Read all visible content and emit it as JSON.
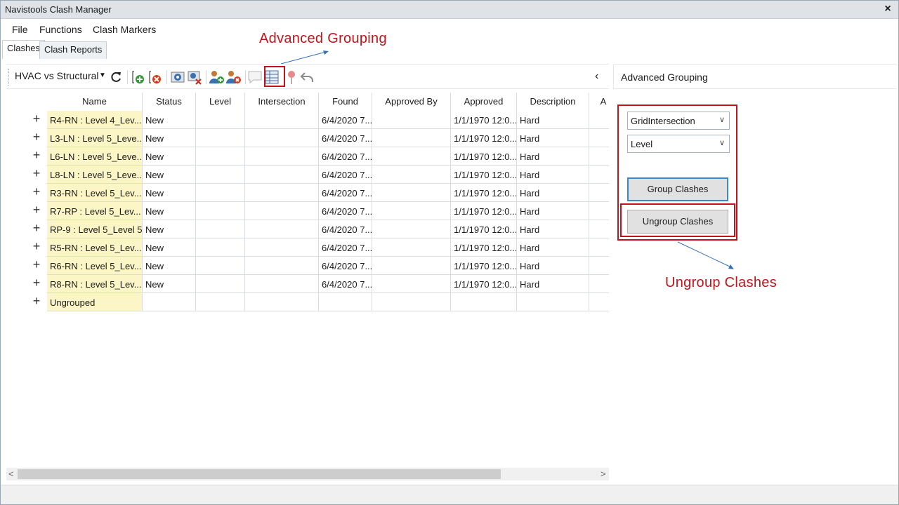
{
  "window": {
    "title": "Navistools Clash Manager",
    "close_label": "×"
  },
  "menu": [
    "File",
    "Functions",
    "Clash Markers"
  ],
  "tabs": [
    "Clashes",
    "Clash Reports"
  ],
  "annotations": {
    "advanced_grouping": "Advanced Grouping",
    "ungroup_clashes": "Ungroup Clashes",
    "color": "#c0141a"
  },
  "toolbar": {
    "test_selector": "HVAC vs Structural",
    "collapse_label": "‹",
    "icons": [
      "refresh-icon",
      "add-clash-icon",
      "remove-clash-icon",
      "view-clash-icon",
      "clear-view-icon",
      "assign-user-icon",
      "unassign-user-icon",
      "comment-icon",
      "advanced-grouping-icon",
      "marker-pin-icon",
      "undo-icon"
    ]
  },
  "grid": {
    "columns": [
      "Name",
      "Status",
      "Level",
      "Intersection",
      "Found",
      "Approved By",
      "Approved",
      "Description",
      "A"
    ],
    "rows": [
      {
        "expander": "+",
        "name": "R4-RN : Level 4_Lev...",
        "status": "New",
        "level": "",
        "intersection": "",
        "found": "6/4/2020 7...",
        "approved_by": "",
        "approved": "1/1/1970 12:0...",
        "description": "Hard"
      },
      {
        "expander": "+",
        "name": "L3-LN : Level 5_Leve...",
        "status": "New",
        "level": "",
        "intersection": "",
        "found": "6/4/2020 7...",
        "approved_by": "",
        "approved": "1/1/1970 12:0...",
        "description": "Hard"
      },
      {
        "expander": "+",
        "name": "L6-LN : Level 5_Leve...",
        "status": "New",
        "level": "",
        "intersection": "",
        "found": "6/4/2020 7...",
        "approved_by": "",
        "approved": "1/1/1970 12:0...",
        "description": "Hard"
      },
      {
        "expander": "+",
        "name": "L8-LN : Level 5_Leve...",
        "status": "New",
        "level": "",
        "intersection": "",
        "found": "6/4/2020 7...",
        "approved_by": "",
        "approved": "1/1/1970 12:0...",
        "description": "Hard"
      },
      {
        "expander": "+",
        "name": "R3-RN : Level 5_Lev...",
        "status": "New",
        "level": "",
        "intersection": "",
        "found": "6/4/2020 7...",
        "approved_by": "",
        "approved": "1/1/1970 12:0...",
        "description": "Hard"
      },
      {
        "expander": "+",
        "name": "R7-RP : Level 5_Lev...",
        "status": "New",
        "level": "",
        "intersection": "",
        "found": "6/4/2020 7...",
        "approved_by": "",
        "approved": "1/1/1970 12:0...",
        "description": "Hard"
      },
      {
        "expander": "+",
        "name": "RP-9 : Level 5_Level 5",
        "status": "New",
        "level": "",
        "intersection": "",
        "found": "6/4/2020 7...",
        "approved_by": "",
        "approved": "1/1/1970 12:0...",
        "description": "Hard"
      },
      {
        "expander": "+",
        "name": "R5-RN : Level 5_Lev...",
        "status": "New",
        "level": "",
        "intersection": "",
        "found": "6/4/2020 7...",
        "approved_by": "",
        "approved": "1/1/1970 12:0...",
        "description": "Hard"
      },
      {
        "expander": "+",
        "name": "R6-RN : Level 5_Lev...",
        "status": "New",
        "level": "",
        "intersection": "",
        "found": "6/4/2020 7...",
        "approved_by": "",
        "approved": "1/1/1970 12:0...",
        "description": "Hard"
      },
      {
        "expander": "+",
        "name": "R8-RN : Level 5_Lev...",
        "status": "New",
        "level": "",
        "intersection": "",
        "found": "6/4/2020 7...",
        "approved_by": "",
        "approved": "1/1/1970 12:0...",
        "description": "Hard"
      },
      {
        "expander": "+",
        "name": "Ungrouped",
        "status": "",
        "level": "",
        "intersection": "",
        "found": "",
        "approved_by": "",
        "approved": "",
        "description": ""
      }
    ]
  },
  "scrollbar": {
    "left_arrow": "<",
    "right_arrow": ">"
  },
  "panel": {
    "title": "Advanced Grouping",
    "group_by_1": "GridIntersection",
    "group_by_2": "Level",
    "group_button": "Group Clashes",
    "ungroup_button": "Ungroup Clashes"
  }
}
